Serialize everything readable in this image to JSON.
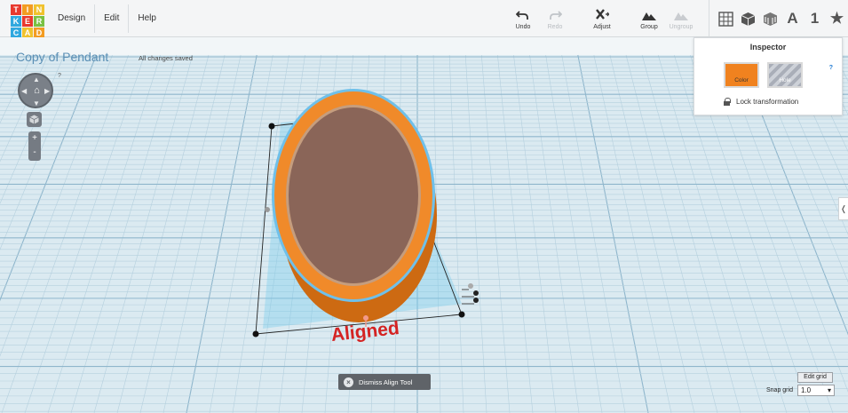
{
  "logo": {
    "letters": [
      "T",
      "I",
      "N",
      "K",
      "E",
      "R",
      "C",
      "A",
      "D"
    ],
    "colors": [
      "#e8392e",
      "#f39c22",
      "#f0c22e",
      "#2fa8df",
      "#e8392e",
      "#7ac143",
      "#2fa8df",
      "#f0c22e",
      "#f39c22"
    ]
  },
  "menu": {
    "items": [
      "Design",
      "Edit",
      "Help"
    ]
  },
  "toolbar": {
    "undo": "Undo",
    "redo": "Redo",
    "adjust": "Adjust",
    "group": "Group",
    "ungroup": "Ungroup"
  },
  "view_icons": {
    "text_glyph": "A",
    "number_glyph": "1",
    "star_glyph": "★"
  },
  "document": {
    "title": "Copy of Pendant",
    "status": "All changes saved"
  },
  "nav": {
    "help": "?"
  },
  "inspector": {
    "title": "Inspector",
    "help": "?",
    "color_label": "Color",
    "hole_label": "Hole",
    "lock_label": "Lock transformation",
    "color_value": "#f0821f"
  },
  "workplane": {
    "aligned_label": "Aligned"
  },
  "dismiss": {
    "label": "Dismiss Align Tool"
  },
  "grid_controls": {
    "edit_grid": "Edit grid",
    "snap_label": "Snap grid",
    "snap_value": "1.0"
  }
}
